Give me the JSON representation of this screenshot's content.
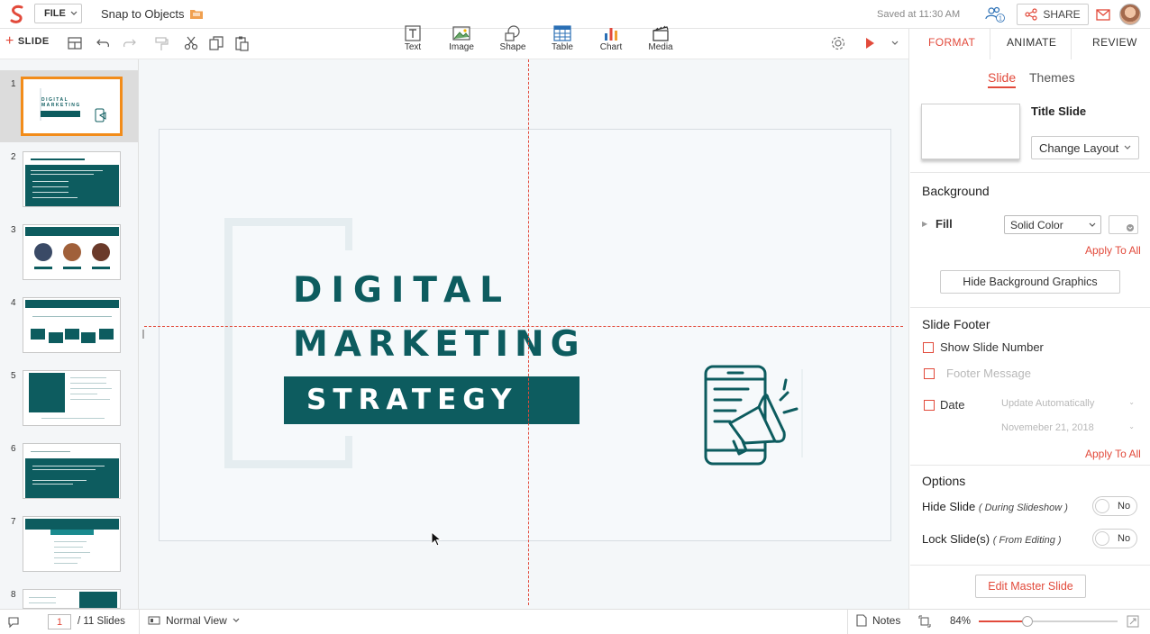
{
  "topbar": {
    "file_label": "FILE",
    "doc_title": "Snap to Objects",
    "saved_text": "Saved at 11:30 AM",
    "collab_count": "1",
    "share_label": "SHARE"
  },
  "toolbar": {
    "add_slide_label": "SLIDE",
    "insert": [
      {
        "label": "Text",
        "icon": "text-box-icon"
      },
      {
        "label": "Image",
        "icon": "image-icon"
      },
      {
        "label": "Shape",
        "icon": "shape-icon"
      },
      {
        "label": "Table",
        "icon": "table-icon"
      },
      {
        "label": "Chart",
        "icon": "chart-icon"
      },
      {
        "label": "Media",
        "icon": "media-icon"
      }
    ]
  },
  "right_tabs": {
    "format": "FORMAT",
    "animate": "ANIMATE",
    "review": "REVIEW",
    "active": "FORMAT"
  },
  "slides": {
    "numbers": [
      "1",
      "2",
      "3",
      "4",
      "5",
      "6",
      "7",
      "8"
    ],
    "selected": 1
  },
  "slide_content": {
    "line1": "DIGITAL",
    "line2": "MARKETING",
    "line3": "STRATEGY"
  },
  "format_panel": {
    "sub_tabs": {
      "slide": "Slide",
      "themes": "Themes"
    },
    "layout_name": "Title Slide",
    "change_layout_label": "Change Layout",
    "background": {
      "title": "Background",
      "fill_label": "Fill",
      "fill_value": "Solid Color",
      "apply_all": "Apply To All",
      "hide_bg_graphics": "Hide Background Graphics"
    },
    "footer": {
      "title": "Slide Footer",
      "show_slide_number": "Show Slide Number",
      "footer_message": "Footer Message",
      "date": "Date",
      "update_automatically": "Update Automatically",
      "date_value": "Novemeber 21, 2018",
      "apply_all": "Apply To All"
    },
    "options": {
      "title": "Options",
      "hide_slide": "Hide Slide",
      "hide_slide_hint": "( During Slideshow )",
      "lock_slide": "Lock Slide(s)",
      "lock_slide_hint": "( From Editing )",
      "toggle_value": "No"
    },
    "edit_master": "Edit Master Slide"
  },
  "statusbar": {
    "current_page": "1",
    "total_slides": "/ 11 Slides",
    "view_mode": "Normal View",
    "notes_label": "Notes",
    "zoom": "84%",
    "zoom_fraction": 0.35
  },
  "colors": {
    "accent": "#e24a3b",
    "teal": "#0d5c5f",
    "selection": "#f28c1a"
  }
}
